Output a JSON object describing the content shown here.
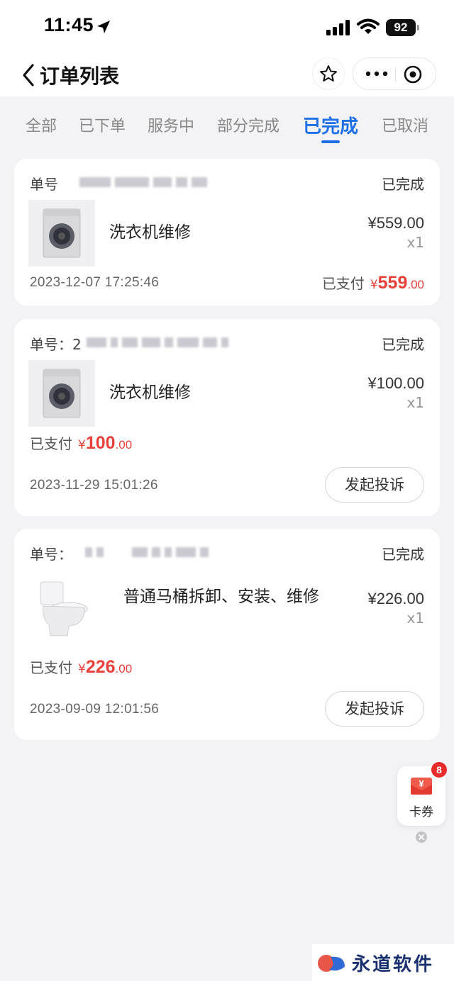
{
  "status_bar": {
    "time": "11:45",
    "battery": "92"
  },
  "nav": {
    "title": "订单列表"
  },
  "tabs": [
    {
      "label": "全部",
      "active": false
    },
    {
      "label": "已下单",
      "active": false
    },
    {
      "label": "服务中",
      "active": false
    },
    {
      "label": "部分完成",
      "active": false
    },
    {
      "label": "已完成",
      "active": true
    },
    {
      "label": "已取消",
      "active": false
    }
  ],
  "orders": [
    {
      "order_label": "单号",
      "status": "已完成",
      "product": "洗衣机维修",
      "image": "washing-machine",
      "price": "¥559.00",
      "qty": "x1",
      "paid_label": "已支付",
      "currency": "¥",
      "paid_int": "559",
      "paid_dec": ".00",
      "date": "2023-12-07 17:25:46"
    },
    {
      "order_label": "单号：2",
      "status": "已完成",
      "product": "洗衣机维修",
      "image": "washing-machine",
      "price": "¥100.00",
      "qty": "x1",
      "paid_label": "已支付",
      "currency": "¥",
      "paid_int": "100",
      "paid_dec": ".00",
      "date": "2023-11-29 15:01:26",
      "action": "发起投诉"
    },
    {
      "order_label": "单号：",
      "status": "已完成",
      "product": "普通马桶拆卸、安装、维修",
      "image": "toilet",
      "price": "¥226.00",
      "qty": "x1",
      "paid_label": "已支付",
      "currency": "¥",
      "paid_int": "226",
      "paid_dec": ".00",
      "date": "2023-09-09 12:01:56",
      "action": "发起投诉"
    }
  ],
  "coupon": {
    "label": "卡券",
    "badge": "8",
    "icon_char": "¥"
  },
  "watermark": {
    "text": "永道软件园"
  },
  "colors": {
    "accent": "#1e6fe8",
    "price_red": "#e8403a",
    "badge_red": "#e82c2c"
  }
}
